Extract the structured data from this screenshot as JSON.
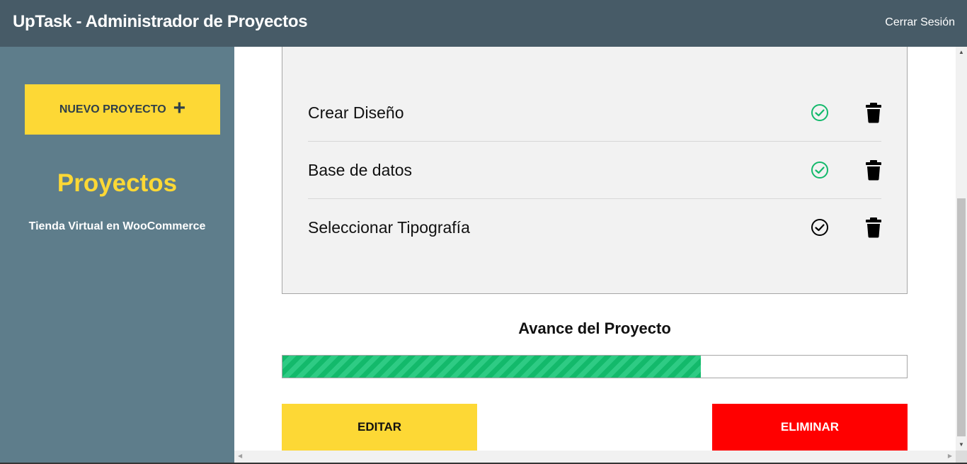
{
  "header": {
    "title": "UpTask - Administrador de Proyectos",
    "logout_label": "Cerrar Sesión"
  },
  "sidebar": {
    "new_project_label": "NUEVO PROYECTO",
    "new_project_icon": "plus-icon",
    "projects_heading": "Proyectos",
    "projects": [
      {
        "label": "Tienda Virtual en WooCommerce"
      }
    ]
  },
  "tasks": [
    {
      "name": "Crear Diseño",
      "completed": true,
      "status_icon": "check-circle-icon",
      "delete_icon": "trash-icon"
    },
    {
      "name": "Base de datos",
      "completed": true,
      "status_icon": "check-circle-icon",
      "delete_icon": "trash-icon"
    },
    {
      "name": "Seleccionar Tipografía",
      "completed": false,
      "status_icon": "check-circle-icon",
      "delete_icon": "trash-icon"
    }
  ],
  "progress": {
    "title": "Avance del Proyecto",
    "percent": 67
  },
  "actions": {
    "edit_label": "EDITAR",
    "delete_label": "ELIMINAR"
  },
  "colors": {
    "header_bg": "#475b67",
    "sidebar_bg": "#5e7d8b",
    "accent_yellow": "#fdd835",
    "complete_green": "#13b96b",
    "danger_red": "#ff0000"
  }
}
